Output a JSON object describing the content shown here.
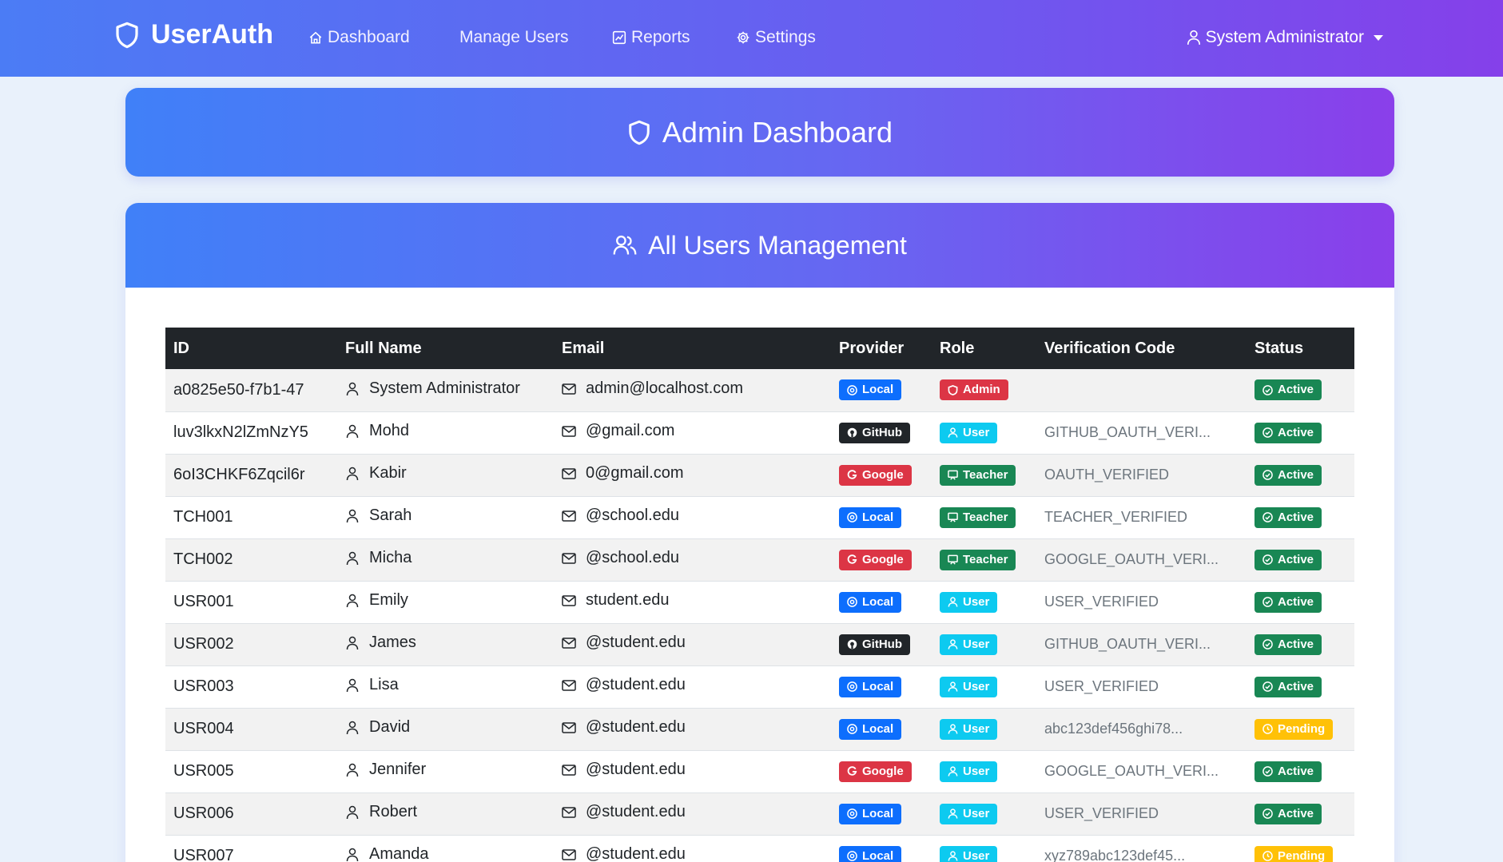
{
  "navbar": {
    "brand": "UserAuth",
    "links": [
      {
        "label": "Dashboard",
        "icon": "home-icon"
      },
      {
        "label": "Manage Users",
        "icon": ""
      },
      {
        "label": "Reports",
        "icon": "chart-icon"
      },
      {
        "label": "Settings",
        "icon": "gear-icon"
      }
    ],
    "user_menu": "System Administrator"
  },
  "dashboard_card": {
    "title": "Admin Dashboard"
  },
  "users_card": {
    "title": "All Users Management",
    "columns": [
      "ID",
      "Full Name",
      "Email",
      "Provider",
      "Role",
      "Verification Code",
      "Status"
    ],
    "rows": [
      {
        "id": "a0825e50-f7b1-47",
        "name": "System Administrator",
        "email": "admin@localhost.com",
        "provider": "Local",
        "role": "Admin",
        "code": "",
        "status": "Active"
      },
      {
        "id": "luv3lkxN2lZmNzY5",
        "name": "Mohd",
        "email": "@gmail.com",
        "provider": "GitHub",
        "role": "User",
        "code": "GITHUB_OAUTH_VERI...",
        "status": "Active"
      },
      {
        "id": "6oI3CHKF6Zqcil6r",
        "name": "Kabir",
        "email": "0@gmail.com",
        "provider": "Google",
        "role": "Teacher",
        "code": "OAUTH_VERIFIED",
        "status": "Active"
      },
      {
        "id": "TCH001",
        "name": "Sarah",
        "email": "@school.edu",
        "provider": "Local",
        "role": "Teacher",
        "code": "TEACHER_VERIFIED",
        "status": "Active"
      },
      {
        "id": "TCH002",
        "name": "Micha",
        "email": "@school.edu",
        "provider": "Google",
        "role": "Teacher",
        "code": "GOOGLE_OAUTH_VERI...",
        "status": "Active"
      },
      {
        "id": "USR001",
        "name": "Emily",
        "email": "student.edu",
        "provider": "Local",
        "role": "User",
        "code": "USER_VERIFIED",
        "status": "Active"
      },
      {
        "id": "USR002",
        "name": "James",
        "email": "@student.edu",
        "provider": "GitHub",
        "role": "User",
        "code": "GITHUB_OAUTH_VERI...",
        "status": "Active"
      },
      {
        "id": "USR003",
        "name": "Lisa",
        "email": "@student.edu",
        "provider": "Local",
        "role": "User",
        "code": "USER_VERIFIED",
        "status": "Active"
      },
      {
        "id": "USR004",
        "name": "David",
        "email": "@student.edu",
        "provider": "Local",
        "role": "User",
        "code": "abc123def456ghi78...",
        "status": "Pending"
      },
      {
        "id": "USR005",
        "name": "Jennifer",
        "email": "@student.edu",
        "provider": "Google",
        "role": "User",
        "code": "GOOGLE_OAUTH_VERI...",
        "status": "Active"
      },
      {
        "id": "USR006",
        "name": "Robert",
        "email": "@student.edu",
        "provider": "Local",
        "role": "User",
        "code": "USER_VERIFIED",
        "status": "Active"
      },
      {
        "id": "USR007",
        "name": "Amanda",
        "email": "@student.edu",
        "provider": "Local",
        "role": "User",
        "code": "xyz789abc123def45...",
        "status": "Pending"
      }
    ]
  },
  "colors": {
    "navbar_start": "#4b7cf5",
    "navbar_end": "#8540ea",
    "table_header": "#212529",
    "badge_local": "#0d6efd",
    "badge_github": "#212529",
    "badge_google": "#dc3545",
    "badge_admin": "#dc3545",
    "badge_user": "#0dcaf0",
    "badge_teacher": "#198754",
    "badge_active": "#198754",
    "badge_pending": "#ffc107"
  }
}
